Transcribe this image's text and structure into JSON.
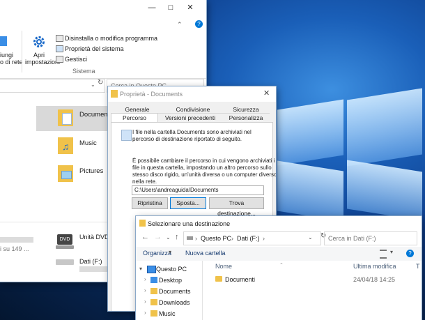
{
  "explorer": {
    "ribbon": {
      "left_label_1": "iungi",
      "left_label_2": "o di rete",
      "settings_label_1": "Apri",
      "settings_label_2": "impostazioni",
      "items": [
        "Disinstalla o modifica programma",
        "Proprietà del sistema",
        "Gestisci"
      ],
      "group_label": "Sistema"
    },
    "search_placeholder": "Cerca in Questo PC",
    "folders": [
      "Documents",
      "Music",
      "Pictures"
    ],
    "drive_label": "Unità DVD (",
    "data_drive_label": "Dati (F:)",
    "left_status": "i su 149 ..."
  },
  "properties": {
    "title": "Proprietà - Documents",
    "tabs_row1": [
      "Generale",
      "Condivisione",
      "Sicurezza"
    ],
    "tabs_row2": [
      "Percorso",
      "Versioni precedenti",
      "Personalizza"
    ],
    "text1": [
      "I file nella cartella Documents sono archiviati nel",
      "percorso di destinazione riportato di seguito."
    ],
    "text2": [
      "È possibile cambiare il percorso in cui vengono archiviati i",
      "file in questa cartella, impostando un altro percorso sullo",
      "stesso disco rigido, un'unità diversa o un computer diverso",
      "nella rete."
    ],
    "path_value": "C:\\Users\\andreaguida\\Documents",
    "buttons": [
      "Ripristina",
      "Sposta...",
      "Trova destinazione..."
    ]
  },
  "dialog": {
    "title": "Selezionare una destinazione",
    "breadcrumb": [
      "Questo PC",
      "Dati (F:)"
    ],
    "search_placeholder": "Cerca in Dati (F:)",
    "toolbar": {
      "organize": "Organizza",
      "new_folder": "Nuova cartella"
    },
    "tree": [
      "Questo PC",
      "Desktop",
      "Documents",
      "Downloads",
      "Music"
    ],
    "columns": [
      "Nome",
      "Ultima modifica",
      "T"
    ],
    "rows": [
      {
        "name": "Documenti",
        "modified": "24/04/18 14:25"
      }
    ]
  },
  "colors": {
    "accent": "#0078d7",
    "folder_yellow": "#f0c24a",
    "desktop_blue": "#0c3a86"
  }
}
